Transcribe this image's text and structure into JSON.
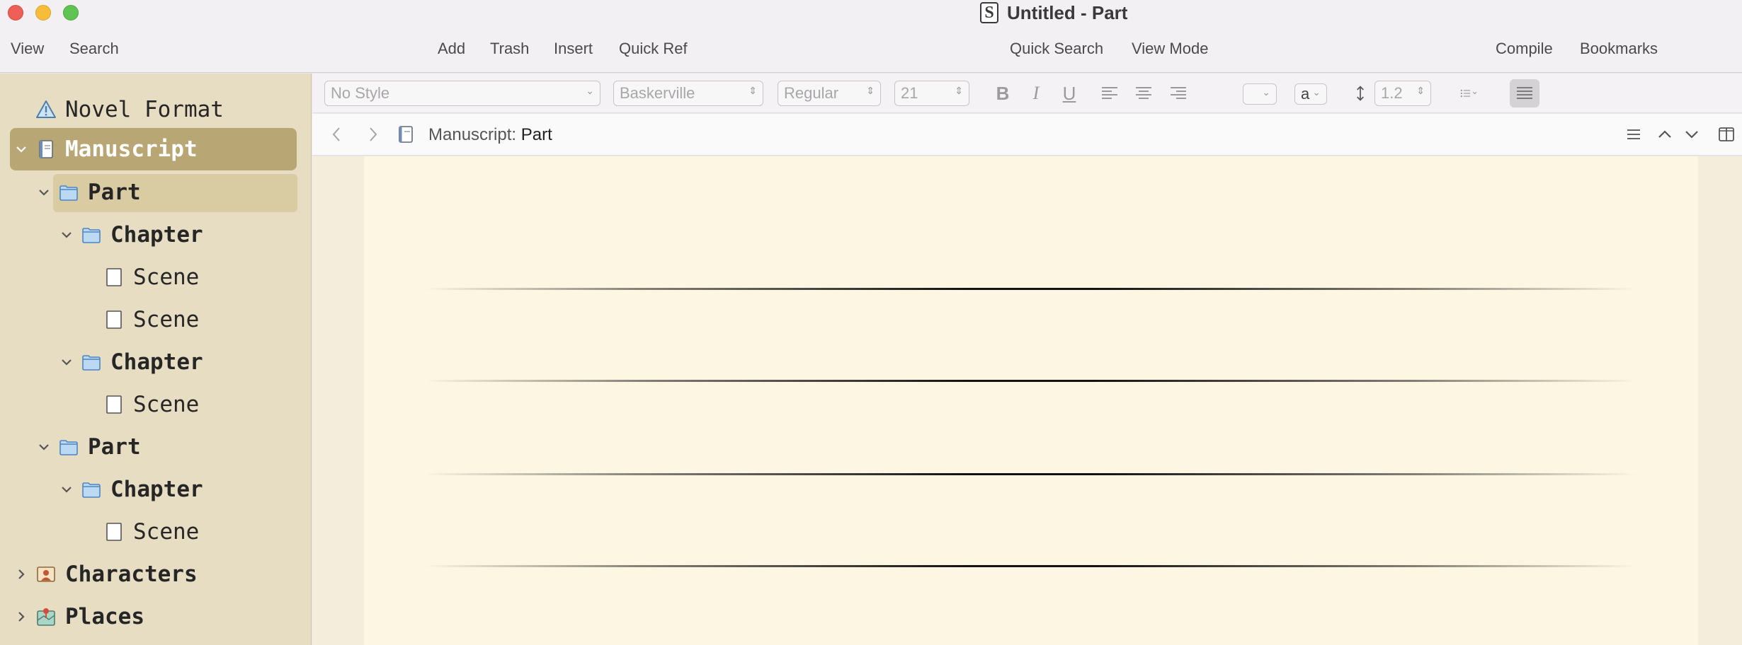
{
  "window": {
    "title": "Untitled - Part",
    "app_icon": "S"
  },
  "toolbar": {
    "view": "View",
    "search": "Search",
    "add": "Add",
    "trash": "Trash",
    "insert": "Insert",
    "quick_ref": "Quick Ref",
    "quick_search": "Quick Search",
    "view_mode": "View Mode",
    "compile": "Compile",
    "bookmarks": "Bookmarks"
  },
  "binder": {
    "items": [
      {
        "label": "Novel Format",
        "icon": "warning-icon",
        "level": 0
      },
      {
        "label": "Manuscript",
        "icon": "manuscript-icon",
        "level": 0,
        "expanded": true,
        "selected": true
      },
      {
        "label": "Part",
        "icon": "folder-icon",
        "level": 1,
        "expanded": true,
        "highlighted": true
      },
      {
        "label": "Chapter",
        "icon": "folder-icon",
        "level": 2,
        "expanded": true
      },
      {
        "label": "Scene",
        "icon": "document-icon",
        "level": 3
      },
      {
        "label": "Scene",
        "icon": "document-icon",
        "level": 3
      },
      {
        "label": "Chapter",
        "icon": "folder-icon",
        "level": 2,
        "expanded": true
      },
      {
        "label": "Scene",
        "icon": "document-icon",
        "level": 3
      },
      {
        "label": "Part",
        "icon": "folder-icon",
        "level": 1,
        "expanded": true
      },
      {
        "label": "Chapter",
        "icon": "folder-icon",
        "level": 2,
        "expanded": true
      },
      {
        "label": "Scene",
        "icon": "document-icon",
        "level": 3
      },
      {
        "label": "Characters",
        "icon": "characters-icon",
        "level": 0,
        "expanded": false
      },
      {
        "label": "Places",
        "icon": "places-icon",
        "level": 0,
        "expanded": false
      }
    ]
  },
  "format_bar": {
    "style": "No Style",
    "font": "Baskerville",
    "weight": "Regular",
    "size": "21",
    "bold": "B",
    "italic": "I",
    "underline": "U",
    "highlight": "a",
    "line_spacing": "1.2"
  },
  "header": {
    "breadcrumb_parent": "Manuscript:",
    "breadcrumb_current": "Part"
  },
  "colors": {
    "binder_bg": "#e7ddc3",
    "binder_selected": "#b8a774",
    "binder_highlight": "#d9cba2",
    "editor_page": "#fcf6e3",
    "editor_margin": "#f4eddb"
  }
}
